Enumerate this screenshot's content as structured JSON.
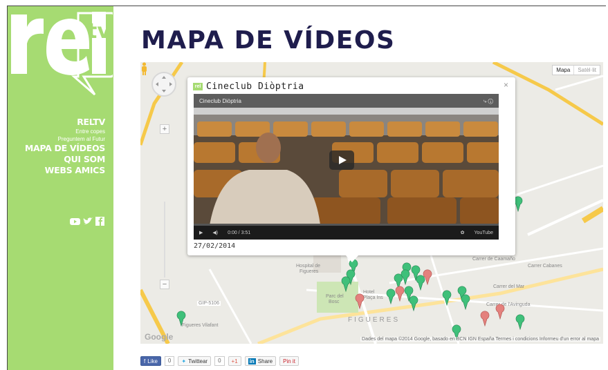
{
  "sidebar": {
    "logo_text": "rel",
    "logo_tv": "tv",
    "nav": [
      {
        "label": "RELTV",
        "size": "big"
      },
      {
        "label": "Entre copes",
        "size": "small"
      },
      {
        "label": "Preguntem al Futur",
        "size": "small"
      },
      {
        "label": "MAPA DE VÍDEOS",
        "size": "big"
      },
      {
        "label": "QUI SOM",
        "size": "big"
      },
      {
        "label": "WEBS AMICS",
        "size": "big"
      }
    ],
    "social_icons": [
      "youtube-icon",
      "twitter-icon",
      "facebook-icon"
    ]
  },
  "page": {
    "title": "MAPA DE VÍDEOS"
  },
  "map": {
    "type_controls": [
      "Mapa",
      "Satèl·lit"
    ],
    "streets": [
      "Hospital de",
      "Figueres",
      "Parc del",
      "Bosc",
      "Hotel",
      "Plaça Ins",
      "FIGUERES",
      "Figueres Vilafant",
      "GIP-5106",
      "Carrer Cabanes",
      "Carrer de Caamaño",
      "Carrer del Mar",
      "Carrer de l'Avinguda"
    ],
    "attribution": "Dades del mapa ©2014 Google, basado en BCN IGN España    Termes i condicions    Informeu d'un error al mapa",
    "google_logo": "Google",
    "popup": {
      "title": "Cineclub Diòptria",
      "video_title": "Cineclub Diòptria",
      "time": "0:00 / 3:51",
      "date": "27/02/2014",
      "close": "×",
      "watermark": "rel",
      "youtube": "YouTube"
    }
  },
  "share": {
    "like_label": "Like",
    "like_count": "0",
    "tweet_label": "Twittear",
    "tweet_count": "0",
    "gplus_label": "+1",
    "linkedin_label": "Share",
    "pin_label": "Pin it"
  },
  "colors": {
    "sidebar": "#a6db72",
    "title": "#1f1d4d",
    "marker_green": "#3fc07a",
    "marker_pink": "#e4817d"
  }
}
